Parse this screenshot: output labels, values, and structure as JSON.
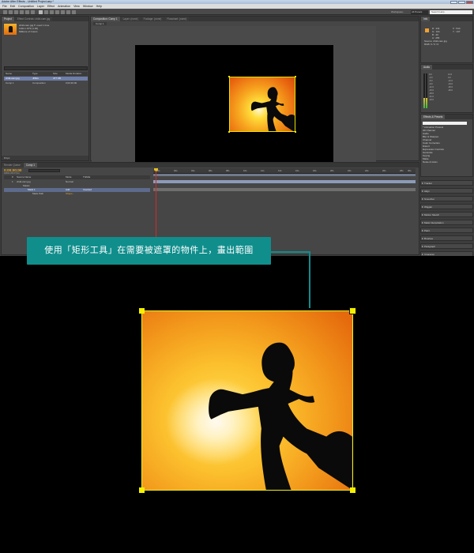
{
  "window": {
    "title": "Adobe After Effects - Untitled Project.aep *"
  },
  "menu": [
    "File",
    "Edit",
    "Composition",
    "Layer",
    "Effect",
    "Animation",
    "View",
    "Window",
    "Help"
  ],
  "toolbar": {
    "workspace_label": "Workspace:",
    "workspace_value": "All Panels",
    "help_search": "Search Help"
  },
  "project": {
    "tabs": [
      "Project",
      "Effect Controls: child-cam.jpg"
    ],
    "selected_name": "child-cam.jpg ▾, used 1 time",
    "selected_dims": "1024 x 879 (1.00)",
    "selected_colors": "Millions of Colors",
    "columns": [
      "Name",
      "Type",
      "Size",
      "Media Duration"
    ],
    "items": [
      {
        "name": "child-cam.jpg",
        "type": "JPEG",
        "size": "477 KB",
        "duration": ""
      },
      {
        "name": "Comp 1",
        "type": "Composition",
        "size": "",
        "duration": "0;00;30;00"
      }
    ],
    "footer": "8 bpc"
  },
  "composition": {
    "tabs": [
      "Composition: Comp 1",
      "Layer: (none)",
      "Footage: (none)",
      "Flowchart: (none)"
    ],
    "subtab": "Comp 1",
    "controls": [
      "50%",
      "0;00;00;00",
      "Half",
      "Active Camera",
      "1 View",
      "+0.0"
    ]
  },
  "info": {
    "tabs": [
      "Info",
      "Audio"
    ],
    "rgba": "R : 231\nG : 161\nB : 40\nA : 255",
    "xy": "X : 544\nY : 137",
    "file": "Source: child-cam.jpg\nRGB: 0 / 0 / 0"
  },
  "audio": {
    "scale_left": [
      "0.0",
      "-3.0",
      "-6.0",
      "-9.0",
      "-12.0",
      "-15.0",
      "-18.0",
      "-21.0",
      "-24.0"
    ],
    "scale_right": [
      "12.0",
      "0.0",
      "-12.0",
      "-24.0",
      "-36.0",
      "-48.0"
    ]
  },
  "effects": {
    "title": "Effects & Presets",
    "items": [
      "* Animation Presets",
      "3D Channel",
      "Audio",
      "Blur & Sharpen",
      "Channel",
      "Color Correction",
      "Distort",
      "Expression Controls",
      "Generate",
      "Keying",
      "Matte",
      "Noise & Grain"
    ]
  },
  "side_panels": [
    "Tracker",
    "Align",
    "Smoother",
    "Wiggler",
    "Motion Sketch",
    "Mask Interpolation",
    "Paint",
    "Brushes",
    "Paragraph",
    "Character"
  ],
  "timeline": {
    "tabs": [
      "Render Queue",
      "Comp 1"
    ],
    "time": "0;00;00;00",
    "frames": "00000 (29.97 fps)",
    "columns": [
      "#",
      "Source Name",
      "Mode",
      "TrkMat"
    ],
    "rows": [
      {
        "num": "1",
        "name": "child-cam.jpg",
        "mode": "Normal",
        "trk": ""
      },
      {
        "num": "",
        "name": "Masks",
        "mode": "",
        "trk": ""
      },
      {
        "num": "",
        "name": "Mask 1",
        "mode": "Add",
        "trk": "Inverted"
      },
      {
        "num": "",
        "name": "Mask Path",
        "mode": "Shape...",
        "trk": ""
      }
    ],
    "ruler": [
      "00s",
      "02s",
      "04s",
      "06s",
      "08s",
      "10s",
      "12s",
      "14s",
      "16s",
      "18s",
      "20s",
      "22s",
      "24s",
      "26s",
      "28s",
      "30s"
    ]
  },
  "callout": {
    "text": "使用「矩形工具」在需要被遮罩的物件上，畫出範圍"
  },
  "colors": {
    "callout": "#108e8c",
    "selection": "#f4f000",
    "ae_bg": "#3d3d3d"
  }
}
